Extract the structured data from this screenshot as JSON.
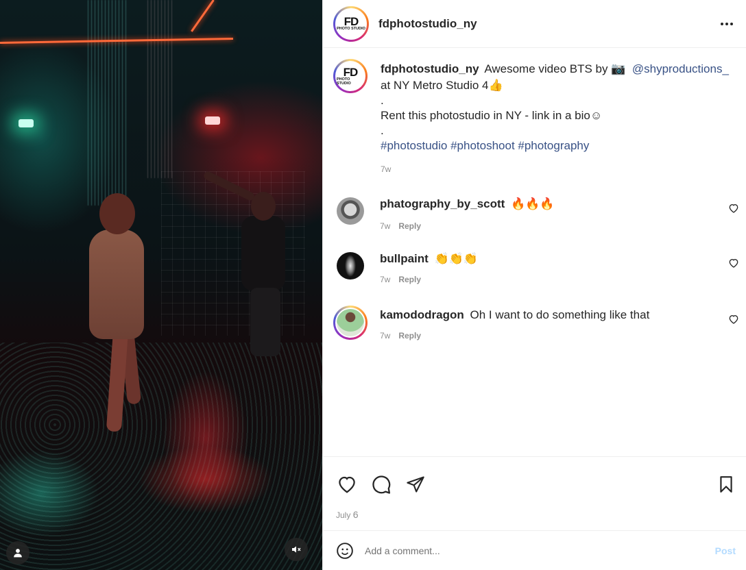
{
  "post": {
    "username": "fdphotostudio_ny",
    "avatar_logo": "FD",
    "avatar_logo_sub": "PHOTO STUDIO",
    "more_icon": "more-horizontal-icon"
  },
  "caption": {
    "username": "fdphotostudio_ny",
    "text_part1": "Awesome video BTS by",
    "camera_emoji": "📷",
    "mention": "@shyproductions_",
    "text_part2": "at NY Metro Studio 4",
    "thumbs_emoji": "👍",
    "dot1": ".",
    "line2": "Rent this photostudio in NY - link in a bio☺",
    "dot2": ".",
    "hashtags": "#photostudio #photoshoot #photography",
    "time": "7w"
  },
  "comments": [
    {
      "username": "phatography_by_scott",
      "text": "🔥🔥🔥",
      "time": "7w",
      "reply": "Reply"
    },
    {
      "username": "bullpaint",
      "text": "👏👏👏",
      "time": "7w",
      "reply": "Reply"
    },
    {
      "username": "kamododragon",
      "text": "Oh I want to do something like that",
      "time": "7w",
      "reply": "Reply"
    }
  ],
  "actions": {
    "icons": [
      "heart-icon",
      "comment-icon",
      "share-icon",
      "bookmark-icon"
    ],
    "date_month": "July",
    "date_day": "6"
  },
  "add_comment": {
    "placeholder": "Add a comment...",
    "post_label": "Post"
  },
  "colors": {
    "link": "#385185",
    "post_disabled": "#b3dbff",
    "meta": "#8e8e8e"
  }
}
